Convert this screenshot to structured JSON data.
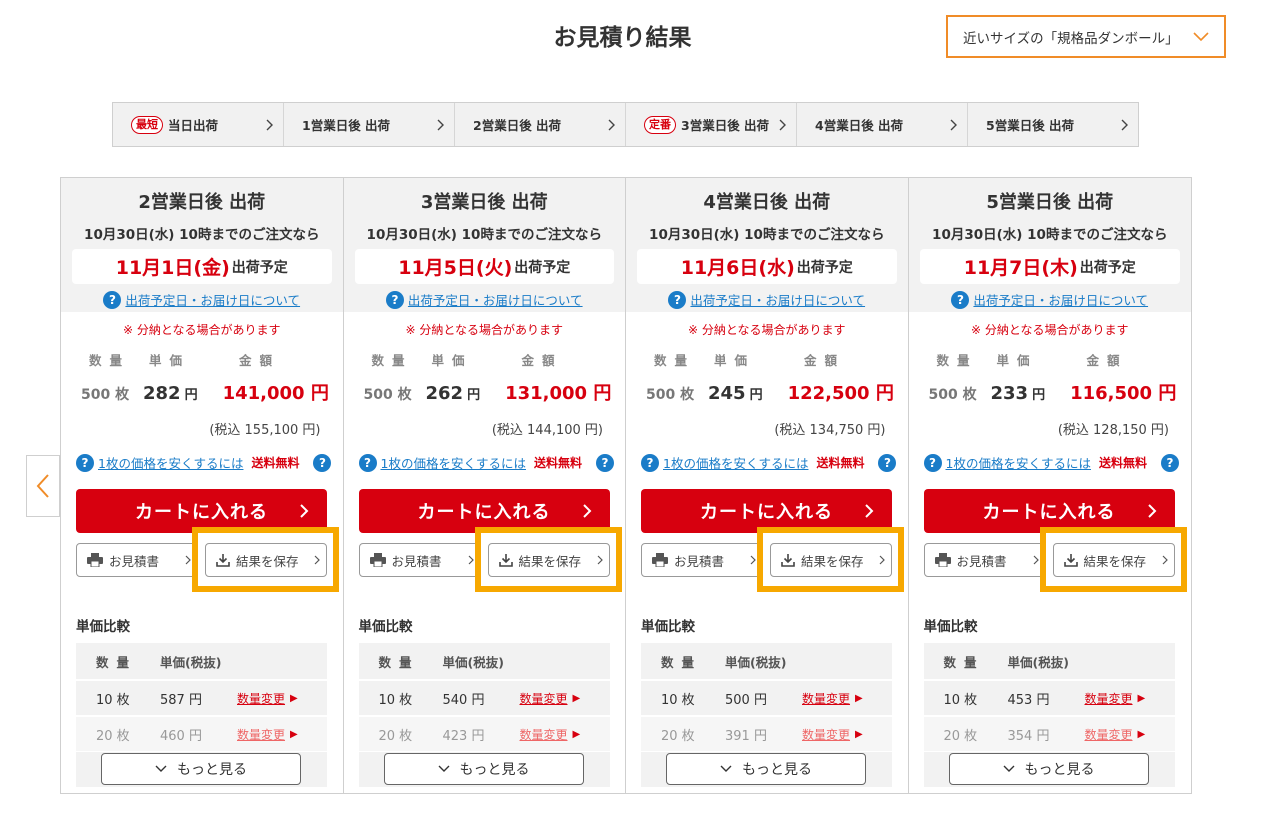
{
  "title": "お見積り結果",
  "size_select": {
    "value": "近いサイズの「規格品ダンボール」"
  },
  "day_tabs": [
    {
      "badge": "最短",
      "label": "当日出荷"
    },
    {
      "badge": "",
      "label": "1営業日後 出荷"
    },
    {
      "badge": "",
      "label": "2営業日後 出荷"
    },
    {
      "badge": "定番",
      "label": "3営業日後 出荷"
    },
    {
      "badge": "",
      "label": "4営業日後 出荷"
    },
    {
      "badge": "",
      "label": "5営業日後 出荷"
    }
  ],
  "labels": {
    "help_link": "出荷予定日・お届け日について",
    "split_note": "※ 分納となる場合があります",
    "col_qty": "数量",
    "col_unit": "単価",
    "col_total": "金額",
    "yen": "円",
    "ship_suffix": "出荷予定",
    "discount_link": "1枚の価格を安くするには",
    "free_shipping": "送料無料",
    "cart": "カートに入れる",
    "quote": "お見積書",
    "save": "結果を保存",
    "compare_title": "単価比較",
    "compare_qty": "数量",
    "compare_unit": "単価(税抜)",
    "change_qty": "数量変更",
    "more": "もっと見る"
  },
  "cards": [
    {
      "title": "2営業日後 出荷",
      "deadline": "10月30日(水) 10時までのご注文なら",
      "ship_date": "11月1日(金)",
      "qty": "500 枚",
      "unit_price": "282",
      "total": "141,000 円",
      "tax_total": "(税込 155,100 円)",
      "compare": [
        {
          "qty": "10 枚",
          "price": "587 円"
        },
        {
          "qty": "20 枚",
          "price": "460 円"
        }
      ]
    },
    {
      "title": "3営業日後 出荷",
      "deadline": "10月30日(水) 10時までのご注文なら",
      "ship_date": "11月5日(火)",
      "qty": "500 枚",
      "unit_price": "262",
      "total": "131,000 円",
      "tax_total": "(税込 144,100 円)",
      "compare": [
        {
          "qty": "10 枚",
          "price": "540 円"
        },
        {
          "qty": "20 枚",
          "price": "423 円"
        }
      ]
    },
    {
      "title": "4営業日後 出荷",
      "deadline": "10月30日(水) 10時までのご注文なら",
      "ship_date": "11月6日(水)",
      "qty": "500 枚",
      "unit_price": "245",
      "total": "122,500 円",
      "tax_total": "(税込 134,750 円)",
      "compare": [
        {
          "qty": "10 枚",
          "price": "500 円"
        },
        {
          "qty": "20 枚",
          "price": "391 円"
        }
      ]
    },
    {
      "title": "5営業日後 出荷",
      "deadline": "10月30日(水) 10時までのご注文なら",
      "ship_date": "11月7日(木)",
      "qty": "500 枚",
      "unit_price": "233",
      "total": "116,500 円",
      "tax_total": "(税込 128,150 円)",
      "compare": [
        {
          "qty": "10 枚",
          "price": "453 円"
        },
        {
          "qty": "20 枚",
          "price": "354 円"
        }
      ]
    }
  ],
  "colors": {
    "accent_red": "#d7000f",
    "link_blue": "#1a7cc8",
    "highlight_orange": "#f7a800",
    "select_border": "#f08c28"
  },
  "icons": {
    "select": "chevron-down-icon",
    "tab": "chevron-right-icon",
    "prev": "chevron-left-icon",
    "help": "question-circle-icon",
    "quote": "printer-icon",
    "save": "download-icon"
  }
}
